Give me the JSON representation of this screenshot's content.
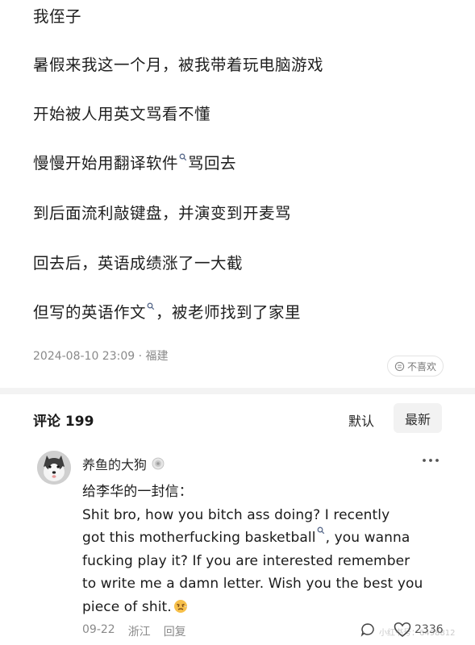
{
  "post": {
    "lines": [
      "我侄子",
      "暑假来我这一个月，被我带着玩电脑游戏",
      "开始被人用英文骂看不懂",
      "慢慢开始用翻译软件",
      "骂回去",
      "到后面流利敲键盘，并演变到开麦骂",
      "回去后，英语成绩涨了一大截",
      "但写的英语作文",
      "，被老师找到了家里"
    ],
    "meta": "2024-08-10 23:09 · 福建",
    "dislike_label": "不喜欢"
  },
  "comments": {
    "title": "评论 199",
    "sort_default": "默认",
    "sort_latest": "最新"
  },
  "comment": {
    "username": "养鱼的大狗",
    "lines": [
      "给李华的一封信：",
      "Shit bro, how you bitch ass doing? I recently",
      "got this motherfucking basketball",
      ", you wanna",
      "fucking play it? If you are interested remember",
      "to write me a damn letter. Wish you the best you",
      "piece of shit."
    ],
    "date": "09-22",
    "location": "浙江",
    "reply_label": "回复",
    "like_count": "2336",
    "watermark": "小红书号：6498812"
  },
  "colors": {
    "text": "#1e1e1e",
    "meta": "#8a8a8a",
    "divider": "#f3f3f3",
    "button_bg": "#f2f2f2"
  },
  "icons": [
    "search-superscript-icon",
    "dislike-icon",
    "badge-icon",
    "more-icon",
    "avatar-husky",
    "angry-face-emoji",
    "reply-icon",
    "heart-icon"
  ]
}
